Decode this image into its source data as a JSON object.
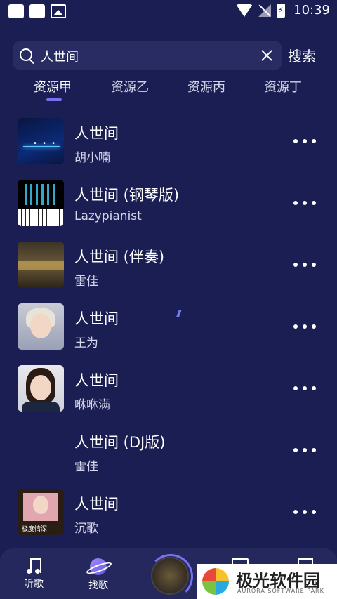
{
  "status_bar": {
    "time": "10:39"
  },
  "search": {
    "value": "人世间",
    "button_label": "搜索"
  },
  "tabs": [
    {
      "label": "资源甲",
      "active": true
    },
    {
      "label": "资源乙",
      "active": false
    },
    {
      "label": "资源丙",
      "active": false
    },
    {
      "label": "资源丁",
      "active": false
    }
  ],
  "songs": [
    {
      "title": "人世间",
      "artist": "胡小喃"
    },
    {
      "title": "人世间 (钢琴版)",
      "artist": "Lazypianist"
    },
    {
      "title": "人世间 (伴奏)",
      "artist": "雷佳"
    },
    {
      "title": "人世间",
      "artist": "王为"
    },
    {
      "title": "人世间",
      "artist": "咻咻满"
    },
    {
      "title": "人世间 (DJ版)",
      "artist": "雷佳"
    },
    {
      "title": "人世间",
      "artist": "沉歌"
    }
  ],
  "cover_texts": {
    "song7_caption": "极度情深"
  },
  "bottom_nav": {
    "listen_label": "听歌",
    "find_label": "找歌"
  },
  "watermark": {
    "name": "极光软件园",
    "sub": "AURORA SOFTWARE PARK"
  },
  "colors": {
    "background": "#1b1e52",
    "accent": "#7b6ef2"
  }
}
